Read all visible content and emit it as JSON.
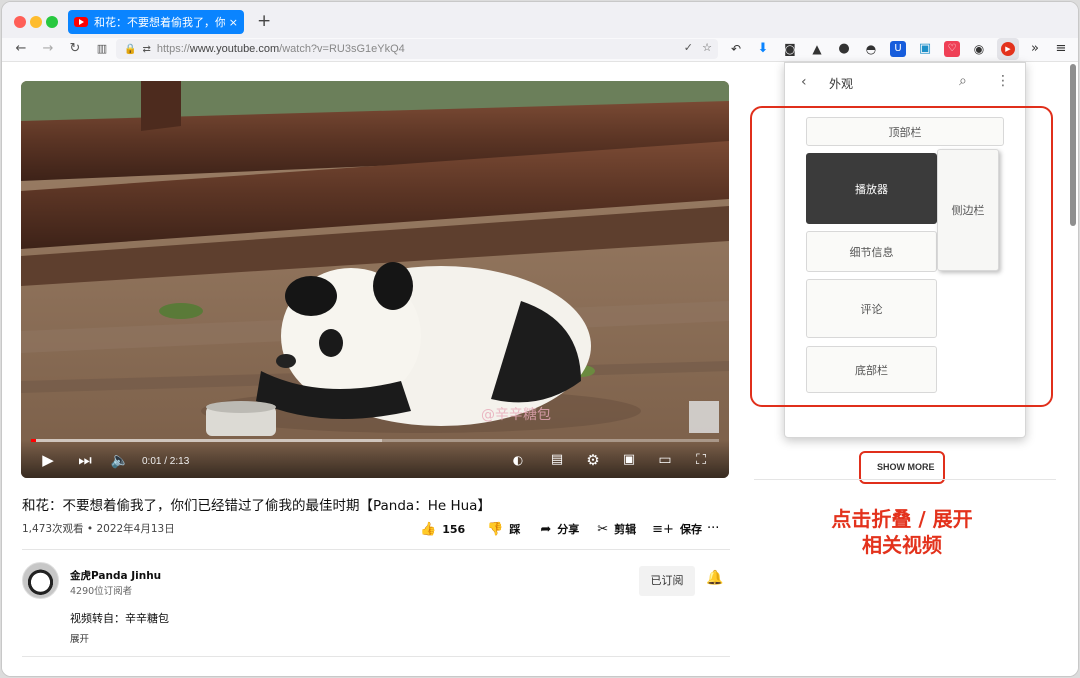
{
  "browser": {
    "tab_title": "和花：不要想着偷我了，你们已经错过了偷我的最佳时期【Panda：He Hua】",
    "tab_close": "×",
    "new_tab": "+",
    "url_scheme": "https://",
    "url_domain": "www.youtube.com",
    "url_path": "/watch?v=RU3sG1eYkQ4"
  },
  "video": {
    "current_time": "0:01",
    "duration": "2:13",
    "time_display": "0:01 / 2:13",
    "progress_fraction": 0.0075,
    "buffered_fraction": 0.51,
    "watermark": "@辛辛糖包"
  },
  "meta": {
    "title": "和花：不要想着偷我了，你们已经错过了偷我的最佳时期【Panda：He Hua】",
    "views": "1,473次观看",
    "date": "2022年4月13日",
    "separator": "•"
  },
  "actions": {
    "like_count": "156",
    "dislike": "踩",
    "share": "分享",
    "clip": "剪辑",
    "save": "保存",
    "more": "···"
  },
  "channel": {
    "name": "金虎Panda Jinhu",
    "subscribers": "4290位订阅者",
    "subscribe_label": "已订阅",
    "description": "视频转自：辛辛糖包",
    "expand": "展开"
  },
  "panel": {
    "title": "外观",
    "blocks": {
      "header": "顶部栏",
      "player": "播放器",
      "sidebar": "侧边栏",
      "details": "细节信息",
      "comments": "评论",
      "footer": "底部栏"
    }
  },
  "sidebar": {
    "show_more": "SHOW MORE"
  },
  "annotation": {
    "line1": "点击折叠 / 展开",
    "line2": "相关视频",
    "color": "#e3321c"
  },
  "colors": {
    "tab_active": "#0a84ff",
    "youtube_red": "#ff0000",
    "player_block": "#3b3b3b"
  }
}
